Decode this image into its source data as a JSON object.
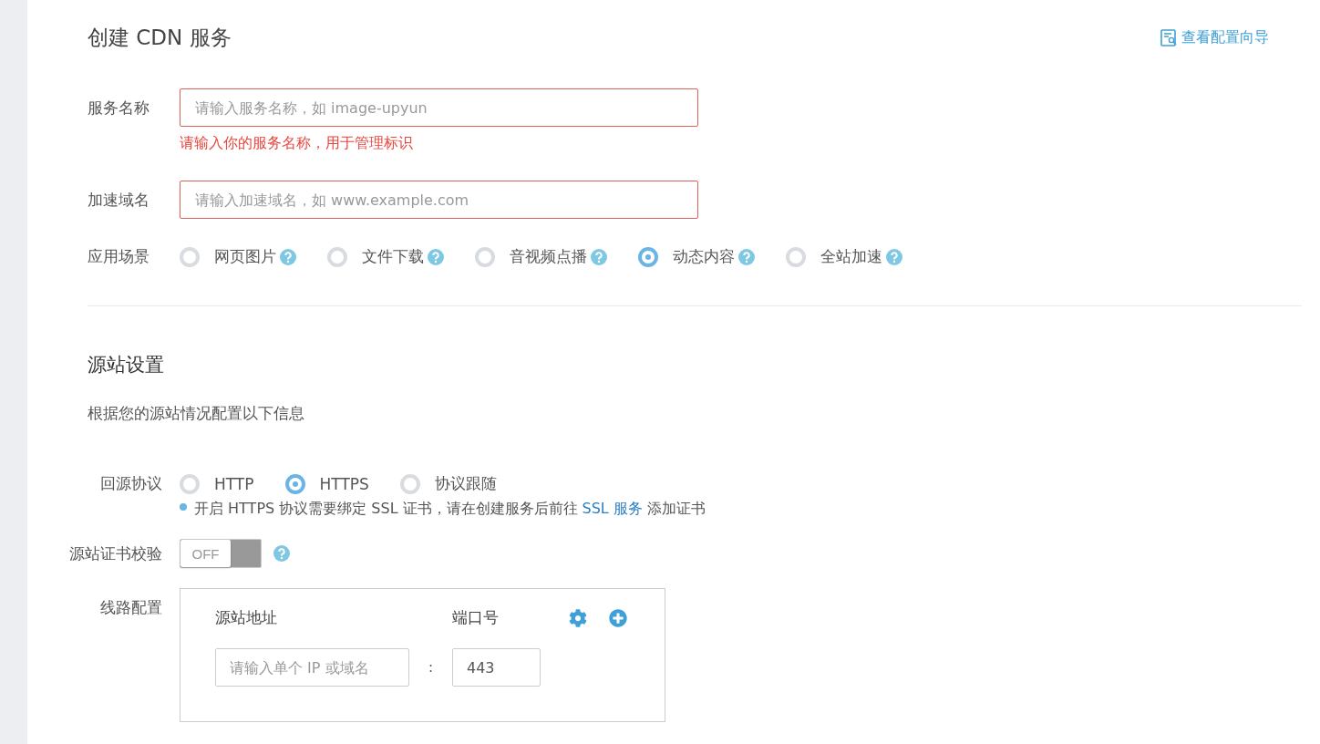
{
  "title": "创建 CDN 服务",
  "guide_link": "查看配置向导",
  "basic": {
    "fields": [
      {
        "label": "服务名称",
        "placeholder": "请输入服务名称，如 image-upyun",
        "error": "请输入你的服务名称，用于管理标识"
      },
      {
        "label": "加速域名",
        "placeholder": "请输入加速域名，如 www.example.com"
      }
    ],
    "scene": {
      "label": "应用场景",
      "options": [
        {
          "label": "网页图片",
          "selected": false
        },
        {
          "label": "文件下载",
          "selected": false
        },
        {
          "label": "音视频点播",
          "selected": false
        },
        {
          "label": "动态内容",
          "selected": true
        },
        {
          "label": "全站加速",
          "selected": false
        }
      ]
    }
  },
  "origin": {
    "title": "源站设置",
    "description": "根据您的源站情况配置以下信息",
    "protocol": {
      "label": "回源协议",
      "options": [
        {
          "label": "HTTP",
          "selected": false
        },
        {
          "label": "HTTPS",
          "selected": true
        },
        {
          "label": "协议跟随",
          "selected": false
        }
      ],
      "note_before": "开启 HTTPS 协议需要绑定 SSL 证书，请在创建服务后前往",
      "note_link": "SSL 服务",
      "note_after": "添加证书"
    },
    "cert_check": {
      "label": "源站证书校验",
      "on": false,
      "text": "OFF"
    },
    "lines": {
      "label": "线路配置",
      "columns": [
        "源站地址",
        "端口号"
      ],
      "address_placeholder": "请输入单个 IP 或域名",
      "separator": ":",
      "port": "443"
    }
  }
}
